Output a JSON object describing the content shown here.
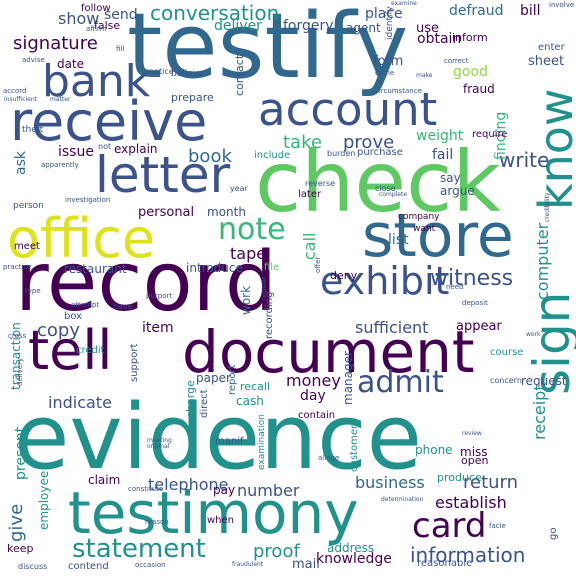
{
  "palette": {
    "dark_purple": "#440154",
    "indigo": "#3b528b",
    "blue": "#31688e",
    "teal": "#21918c",
    "sea_green": "#35b779",
    "green": "#5ec962",
    "yellow_green": "#90d743",
    "yellow": "#dde318"
  },
  "words": [
    {
      "text": "evidence",
      "color": "teal"
    },
    {
      "text": "testify",
      "color": "blue"
    },
    {
      "text": "check",
      "color": "green"
    },
    {
      "text": "record",
      "color": "dark_purple"
    },
    {
      "text": "testimony",
      "color": "teal"
    },
    {
      "text": "document",
      "color": "dark_purple"
    },
    {
      "text": "office",
      "color": "yellow"
    },
    {
      "text": "store",
      "color": "blue"
    },
    {
      "text": "receive",
      "color": "indigo"
    },
    {
      "text": "account",
      "color": "indigo"
    },
    {
      "text": "letter",
      "color": "indigo"
    },
    {
      "text": "bank",
      "color": "indigo"
    },
    {
      "text": "know",
      "color": "teal"
    },
    {
      "text": "sign",
      "color": "teal"
    },
    {
      "text": "tell",
      "color": "dark_purple"
    },
    {
      "text": "exhibit",
      "color": "indigo"
    },
    {
      "text": "card",
      "color": "dark_purple"
    },
    {
      "text": "statement",
      "color": "teal"
    },
    {
      "text": "admit",
      "color": "indigo"
    },
    {
      "text": "note",
      "color": "sea_green"
    },
    {
      "text": "witness",
      "color": "indigo"
    },
    {
      "text": "conversation",
      "color": "teal"
    },
    {
      "text": "information",
      "color": "indigo"
    },
    {
      "text": "write",
      "color": "indigo"
    },
    {
      "text": "signature",
      "color": "dark_purple"
    },
    {
      "text": "prove",
      "color": "indigo"
    },
    {
      "text": "proof",
      "color": "teal"
    },
    {
      "text": "return",
      "color": "indigo"
    },
    {
      "text": "business",
      "color": "blue"
    },
    {
      "text": "give",
      "color": "blue"
    },
    {
      "text": "computer",
      "color": "teal"
    },
    {
      "text": "receipt",
      "color": "teal"
    },
    {
      "text": "take",
      "color": "sea_green"
    },
    {
      "text": "book",
      "color": "blue"
    },
    {
      "text": "copy",
      "color": "indigo"
    },
    {
      "text": "money",
      "color": "dark_purple"
    },
    {
      "text": "telephone",
      "color": "indigo"
    },
    {
      "text": "tape",
      "color": "dark_purple"
    },
    {
      "text": "call",
      "color": "sea_green"
    },
    {
      "text": "indicate",
      "color": "indigo"
    },
    {
      "text": "number",
      "color": "indigo"
    },
    {
      "text": "sufficient",
      "color": "indigo"
    },
    {
      "text": "establish",
      "color": "dark_purple"
    },
    {
      "text": "show",
      "color": "indigo"
    },
    {
      "text": "send",
      "color": "indigo"
    },
    {
      "text": "deliver",
      "color": "teal"
    },
    {
      "text": "forgery",
      "color": "indigo"
    },
    {
      "text": "defraud",
      "color": "blue"
    },
    {
      "text": "bill",
      "color": "dark_purple"
    },
    {
      "text": "place",
      "color": "indigo"
    },
    {
      "text": "obtain",
      "color": "dark_purple"
    },
    {
      "text": "agent",
      "color": "indigo"
    },
    {
      "text": "form",
      "color": "indigo"
    },
    {
      "text": "good",
      "color": "yellow_green"
    },
    {
      "text": "sheet",
      "color": "indigo"
    },
    {
      "text": "fraud",
      "color": "dark_purple"
    },
    {
      "text": "weight",
      "color": "sea_green"
    },
    {
      "text": "fail",
      "color": "indigo"
    },
    {
      "text": "finding",
      "color": "sea_green"
    },
    {
      "text": "issue",
      "color": "dark_purple"
    },
    {
      "text": "explain",
      "color": "dark_purple"
    },
    {
      "text": "personal",
      "color": "dark_purple"
    },
    {
      "text": "month",
      "color": "indigo"
    },
    {
      "text": "list",
      "color": "blue"
    },
    {
      "text": "ask",
      "color": "blue"
    },
    {
      "text": "present",
      "color": "teal"
    },
    {
      "text": "restaurant",
      "color": "indigo"
    },
    {
      "text": "introduce",
      "color": "indigo"
    },
    {
      "text": "item",
      "color": "dark_purple"
    },
    {
      "text": "work",
      "color": "blue"
    },
    {
      "text": "cash",
      "color": "teal"
    },
    {
      "text": "day",
      "color": "dark_purple"
    },
    {
      "text": "manager",
      "color": "indigo"
    },
    {
      "text": "paper",
      "color": "indigo"
    },
    {
      "text": "report",
      "color": "blue"
    },
    {
      "text": "recall",
      "color": "teal"
    },
    {
      "text": "charge",
      "color": "teal"
    },
    {
      "text": "appear",
      "color": "dark_purple"
    },
    {
      "text": "course",
      "color": "teal"
    },
    {
      "text": "request",
      "color": "indigo"
    },
    {
      "text": "phone",
      "color": "teal"
    },
    {
      "text": "customer",
      "color": "teal"
    },
    {
      "text": "pay",
      "color": "dark_purple"
    },
    {
      "text": "claim",
      "color": "dark_purple"
    },
    {
      "text": "mail",
      "color": "indigo"
    },
    {
      "text": "address",
      "color": "teal"
    },
    {
      "text": "knowledge",
      "color": "dark_purple"
    },
    {
      "text": "employee",
      "color": "teal"
    },
    {
      "text": "keep",
      "color": "dark_purple"
    },
    {
      "text": "date",
      "color": "dark_purple"
    },
    {
      "text": "false",
      "color": "dark_purple"
    },
    {
      "text": "follow",
      "color": "dark_purple"
    },
    {
      "text": "transaction",
      "color": "teal"
    },
    {
      "text": "credit",
      "color": "teal"
    },
    {
      "text": "contain",
      "color": "dark_purple"
    },
    {
      "text": "recording",
      "color": "indigo"
    },
    {
      "text": "file",
      "color": "green"
    },
    {
      "text": "deny",
      "color": "dark_purple"
    },
    {
      "text": "say",
      "color": "indigo"
    },
    {
      "text": "argue",
      "color": "indigo"
    },
    {
      "text": "later",
      "color": "dark_purple"
    },
    {
      "text": "purchase",
      "color": "indigo"
    },
    {
      "text": "include",
      "color": "teal"
    },
    {
      "text": "prepare",
      "color": "indigo"
    },
    {
      "text": "contact",
      "color": "indigo"
    },
    {
      "text": "require",
      "color": "dark_purple"
    },
    {
      "text": "meet",
      "color": "dark_purple"
    },
    {
      "text": "produce",
      "color": "teal"
    },
    {
      "text": "miss",
      "color": "dark_purple"
    },
    {
      "text": "open",
      "color": "dark_purple"
    },
    {
      "text": "inform",
      "color": "dark_purple"
    },
    {
      "text": "enter",
      "color": "indigo"
    },
    {
      "text": "use",
      "color": "dark_purple"
    },
    {
      "text": "support",
      "color": "indigo"
    },
    {
      "text": "direct",
      "color": "indigo"
    },
    {
      "text": "examination",
      "color": "teal"
    },
    {
      "text": "manif",
      "color": "indigo"
    },
    {
      "text": "when",
      "color": "dark_purple"
    },
    {
      "text": "go",
      "color": "indigo"
    },
    {
      "text": "box",
      "color": "indigo"
    },
    {
      "text": "company",
      "color": "dark_purple"
    },
    {
      "text": "want",
      "color": "dark_purple"
    },
    {
      "text": "have",
      "color": "indigo"
    },
    {
      "text": "examine",
      "color": "indigo"
    },
    {
      "text": "identify",
      "color": "indigo"
    },
    {
      "text": "believe",
      "color": "indigo"
    },
    {
      "text": "notice",
      "color": "indigo"
    },
    {
      "text": "fill",
      "color": "indigo"
    },
    {
      "text": "advise",
      "color": "indigo"
    },
    {
      "text": "affirm",
      "color": "indigo"
    },
    {
      "text": "theft",
      "color": "indigo"
    },
    {
      "text": "not",
      "color": "indigo"
    },
    {
      "text": "year",
      "color": "indigo"
    },
    {
      "text": "close",
      "color": "indigo"
    },
    {
      "text": "reverse",
      "color": "indigo"
    },
    {
      "text": "burden",
      "color": "indigo"
    },
    {
      "text": "investigation",
      "color": "indigo"
    },
    {
      "text": "person",
      "color": "indigo"
    },
    {
      "text": "circumstance",
      "color": "indigo"
    },
    {
      "text": "come",
      "color": "indigo"
    },
    {
      "text": "correct",
      "color": "indigo"
    },
    {
      "text": "make",
      "color": "indigo"
    },
    {
      "text": "complete",
      "color": "indigo"
    },
    {
      "text": "deposit",
      "color": "indigo"
    },
    {
      "text": "need",
      "color": "indigo"
    },
    {
      "text": "offer",
      "color": "indigo"
    },
    {
      "text": "involve",
      "color": "indigo"
    },
    {
      "text": "review",
      "color": "indigo"
    },
    {
      "text": "attempt",
      "color": "indigo"
    },
    {
      "text": "purport",
      "color": "indigo"
    },
    {
      "text": "concern",
      "color": "indigo"
    },
    {
      "text": "meeting",
      "color": "indigo"
    },
    {
      "text": "original",
      "color": "indigo"
    },
    {
      "text": "allege",
      "color": "indigo"
    },
    {
      "text": "reason",
      "color": "indigo"
    },
    {
      "text": "constitute",
      "color": "indigo"
    },
    {
      "text": "contend",
      "color": "indigo"
    },
    {
      "text": "occasion",
      "color": "indigo"
    },
    {
      "text": "reasonable",
      "color": "indigo"
    },
    {
      "text": "fraudulent",
      "color": "indigo"
    },
    {
      "text": "discuss",
      "color": "indigo"
    },
    {
      "text": "facie",
      "color": "indigo"
    },
    {
      "text": "apparently",
      "color": "indigo"
    },
    {
      "text": "insufficient",
      "color": "indigo"
    },
    {
      "text": "matter",
      "color": "indigo"
    },
    {
      "text": "accord",
      "color": "indigo"
    },
    {
      "text": "type",
      "color": "indigo"
    },
    {
      "text": "practice",
      "color": "indigo"
    },
    {
      "text": "cross",
      "color": "indigo"
    },
    {
      "text": "credibility",
      "color": "indigo"
    },
    {
      "text": "delivery",
      "color": "indigo"
    },
    {
      "text": "determination",
      "color": "indigo"
    },
    {
      "text": "register",
      "color": "indigo"
    },
    {
      "text": "work",
      "color": "indigo"
    }
  ]
}
